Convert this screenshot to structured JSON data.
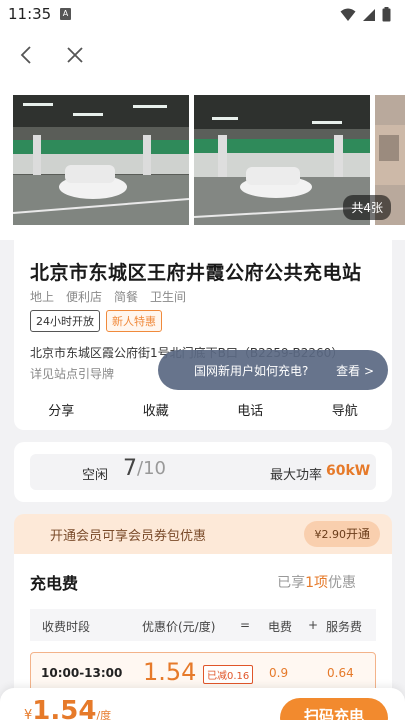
{
  "status_bar": {
    "time": "11:35",
    "app_badge": "A"
  },
  "gallery": {
    "photo_count": "共4张"
  },
  "station": {
    "title": "北京市东城区王府井霞公府公共充电站",
    "facilities": [
      "地上",
      "便利店",
      "简餐",
      "卫生间"
    ],
    "tags": [
      "24小时开放",
      "新人特惠"
    ],
    "address": "北京市东城区霞公府街1号北门底下B口（B2259-B2260）",
    "guide": "详见站点引导牌",
    "actions": [
      "分享",
      "收藏",
      "电话",
      "导航"
    ]
  },
  "tooltip": {
    "question": "国网新用户如何充电?",
    "view": "查看 >"
  },
  "status": {
    "idle_label": "空闲",
    "idle_count": "7",
    "idle_total": "/10",
    "power_label": "最大功率",
    "power_value": "60kW"
  },
  "member": {
    "text": "开通会员可享会员券包优惠",
    "btn_price": "¥2.90",
    "btn_label": "开通"
  },
  "fee": {
    "title": "充电费",
    "discount_prefix": "已享",
    "discount_count": "1项",
    "discount_suffix": "优惠",
    "headers": {
      "period": "收费时段",
      "price": "优惠价(元/度)",
      "eq": "=",
      "elec": "电费",
      "plus": "+",
      "service": "服务费"
    },
    "row": {
      "period": "10:00-13:00",
      "price": "1.54",
      "badge": "已减0.16",
      "elec": "0.9",
      "service": "0.64"
    }
  },
  "bottom": {
    "currency": "¥",
    "price": "1.54",
    "unit": "/度",
    "button": "扫码充电"
  },
  "colors": {
    "accent": "#f28a2e",
    "tooltip": "#5a6882",
    "banner": "#fde9d8"
  }
}
